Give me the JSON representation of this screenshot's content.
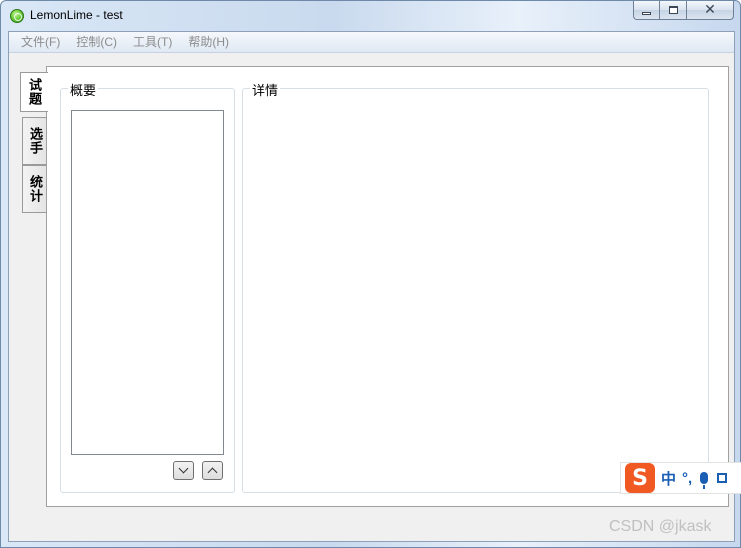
{
  "window": {
    "title": "LemonLime - test",
    "caption_buttons": {
      "minimize_icon": "minimize-icon",
      "maximize_icon": "maximize-icon",
      "close_glyph": "✕"
    }
  },
  "menubar": {
    "items": [
      "文件(F)",
      "控制(C)",
      "工具(T)",
      "帮助(H)"
    ]
  },
  "tabs": {
    "items": [
      "试题",
      "选手",
      "统计"
    ],
    "active": "试题"
  },
  "problems": {
    "summary_title": "概要",
    "details_title": "详情"
  },
  "ime": {
    "logo": "S",
    "lang": "中",
    "punct": "°,"
  },
  "watermark": "CSDN @jkask",
  "colors": {
    "menu_text_disabled": "#8c8c8c",
    "ime_blue": "#1a5fb4",
    "ime_logo": "#f05a22"
  }
}
